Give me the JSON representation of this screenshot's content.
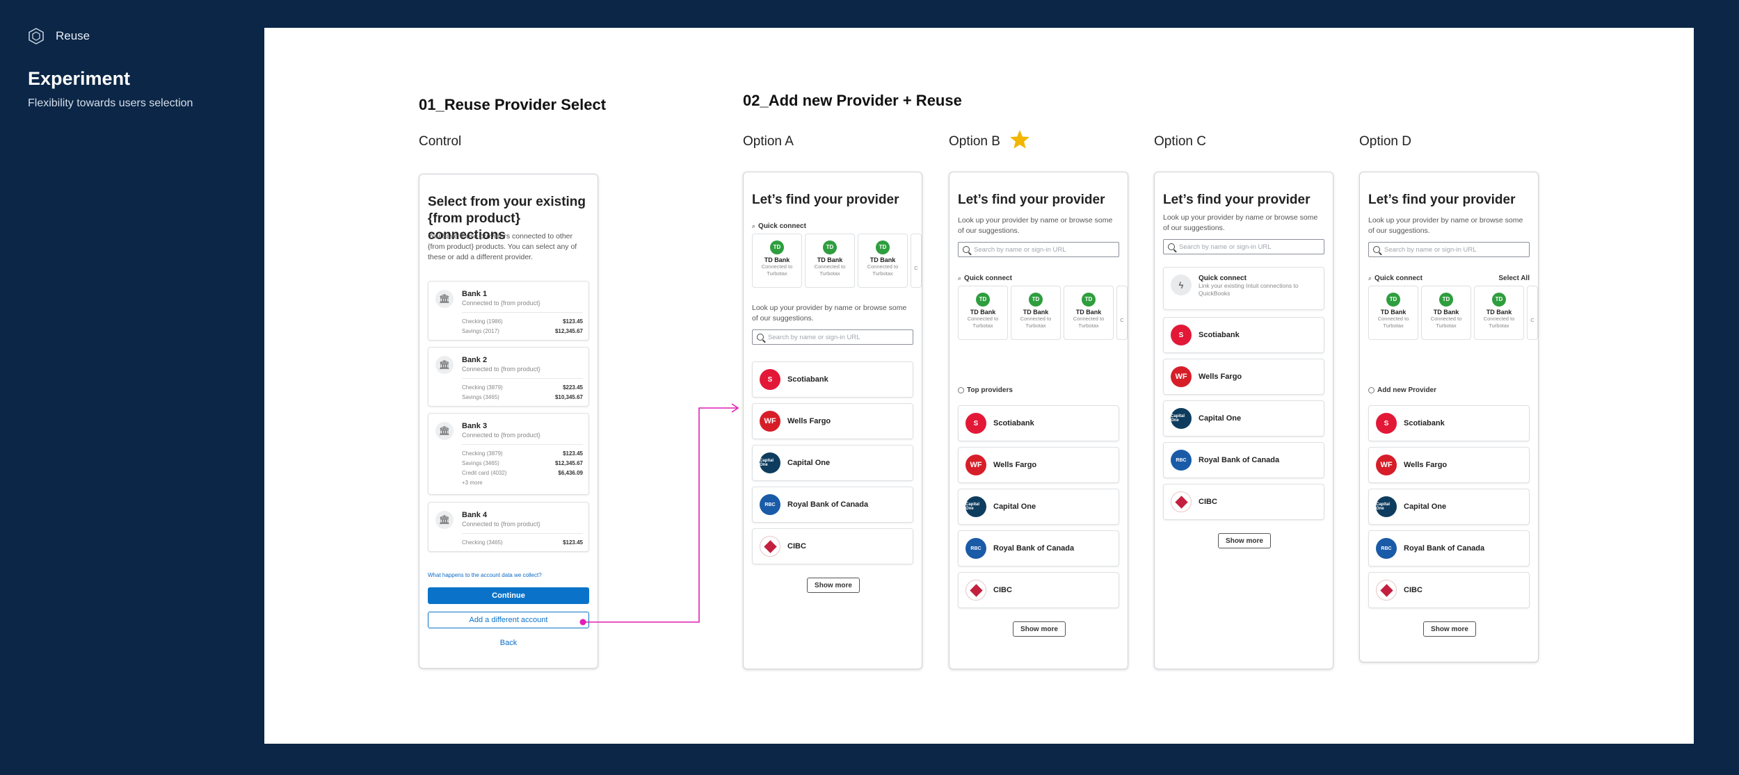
{
  "brand": {
    "name": "Reuse"
  },
  "experiment": {
    "title": "Experiment",
    "subtitle": "Flexibility towards users selection"
  },
  "sections": {
    "s1": "01_Reuse Provider Select",
    "s2": "02_Add new  Provider + Reuse"
  },
  "columns": {
    "control": "Control",
    "a": "Option A",
    "b": "Option B",
    "c": "Option C",
    "d": "Option D"
  },
  "control": {
    "title": "Select from your existing {from product} connections",
    "desc": "You have these providers connected to other {from product} products. You can select any of these or add a different provider.",
    "banks": [
      {
        "name": "Bank 1",
        "conn": "Connected to {from product}",
        "accounts": [
          {
            "label": "Checking (1986)",
            "amount": "$123.45"
          },
          {
            "label": "Savings (2017)",
            "amount": "$12,345.67"
          }
        ]
      },
      {
        "name": "Bank 2",
        "conn": "Connected to {from product}",
        "accounts": [
          {
            "label": "Checking (3879)",
            "amount": "$223.45"
          },
          {
            "label": "Savings (3465)",
            "amount": "$10,345.67"
          }
        ]
      },
      {
        "name": "Bank 3",
        "conn": "Connected to {from product}",
        "accounts": [
          {
            "label": "Checking (3879)",
            "amount": "$123.45"
          },
          {
            "label": "Savings (3465)",
            "amount": "$12,345.67"
          },
          {
            "label": "Credit card (4032)",
            "amount": "$6,436.09"
          }
        ],
        "more": "+3 more"
      },
      {
        "name": "Bank 4",
        "conn": "Connected to {from product}",
        "accounts": [
          {
            "label": "Checking (3465)",
            "amount": "$123.45"
          }
        ]
      }
    ],
    "link": "What happens to the account data we collect?",
    "continue": "Continue",
    "add": "Add a different account",
    "back": "Back"
  },
  "provider": {
    "title": "Let’s find your provider",
    "lookup": "Look up your provider by name or browse some of our suggestions.",
    "search_placeholder": "Search by name or sign-in URL",
    "quick_connect": "Quick connect",
    "select_all": "Select All",
    "top_providers": "Top providers",
    "add_new": "Add new Provider",
    "show_more": "Show more",
    "qc": {
      "logo": "TD",
      "name": "TD Bank",
      "sub1": "Connected to",
      "sub2": "Turbotax",
      "partial": "C"
    },
    "intuit": {
      "name": "Quick connect",
      "desc": "Link your existing Intuit connections to QuickBooks"
    },
    "banks": [
      "Scotiabank",
      "Wells Fargo",
      "Capital One",
      "Royal Bank of Canada",
      "CIBC"
    ],
    "logos": {
      "wf": "WF",
      "cap": "Capital One",
      "rbc": "RBC"
    }
  },
  "colors": {
    "background": "#0b2646",
    "primary": "#0a73c9",
    "connector": "#e01fb4",
    "star": "#f2b600",
    "td_green": "#2e9e3e"
  }
}
